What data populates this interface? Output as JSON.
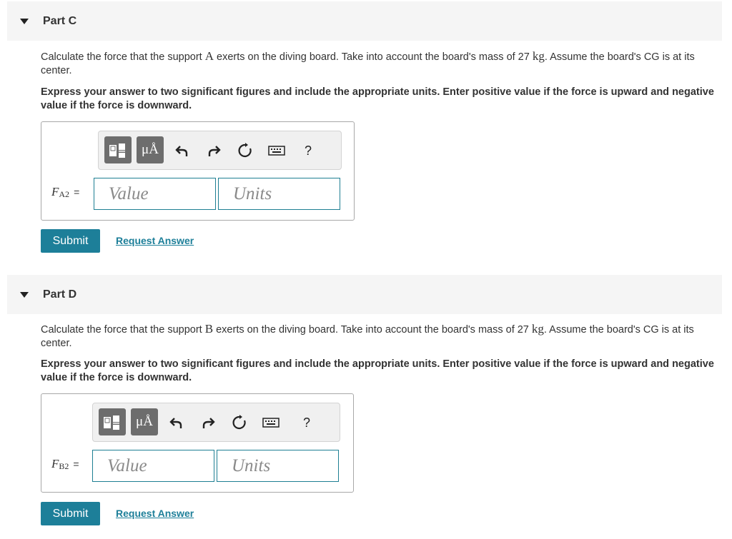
{
  "parts": [
    {
      "title": "Part C",
      "prompt_before": "Calculate the force that the support ",
      "support_symbol": "A",
      "prompt_mid": " exerts on the diving board. Take into account the board's mass of 27 ",
      "mass_unit": "kg",
      "prompt_after": ". Assume the board's CG is at its center.",
      "instructions": "Express your answer to two significant figures and include the appropriate units. Enter positive value if the force is upward and negative value if the force is downward.",
      "variable": "F",
      "variable_sub": "A2",
      "equals": "=",
      "value_placeholder": "Value",
      "units_placeholder": "Units",
      "submit_label": "Submit",
      "request_label": "Request Answer"
    },
    {
      "title": "Part D",
      "prompt_before": "Calculate the force that the support ",
      "support_symbol": "B",
      "prompt_mid": " exerts on the diving board. Take into account the board's mass of 27 ",
      "mass_unit": "kg",
      "prompt_after": ". Assume the board's CG is at its center.",
      "instructions": "Express your answer to two significant figures and include the appropriate units. Enter positive value if the force is upward and negative value if the force is downward.",
      "variable": "F",
      "variable_sub": "B2",
      "equals": "=",
      "value_placeholder": "Value",
      "units_placeholder": "Units",
      "submit_label": "Submit",
      "request_label": "Request Answer"
    }
  ],
  "toolbar": {
    "units_label": "μÅ",
    "help_label": "?",
    "icons": [
      "templates-icon",
      "units-icon",
      "undo-icon",
      "redo-icon",
      "reset-icon",
      "keyboard-icon",
      "help-icon"
    ]
  },
  "colors": {
    "accent": "#1d7f99",
    "header_bg": "#f5f5f5",
    "toolbar_dark": "#6d6d6d"
  }
}
